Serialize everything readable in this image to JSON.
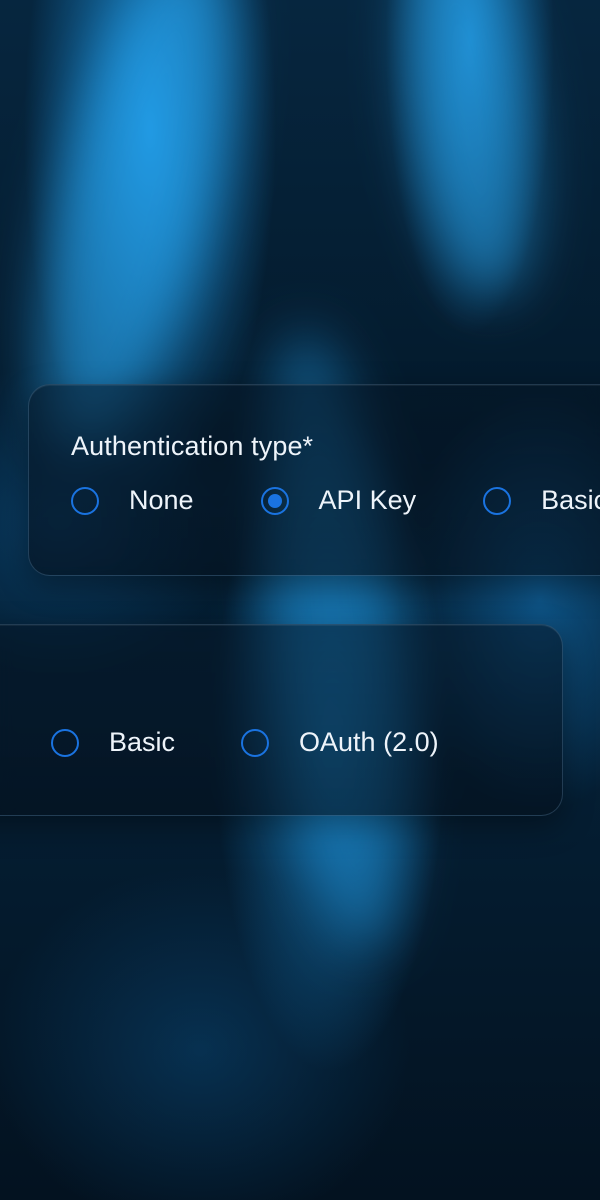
{
  "auth_card_primary": {
    "title": "Authentication type*",
    "options": [
      {
        "label": "None",
        "selected": false
      },
      {
        "label": "API Key",
        "selected": true
      },
      {
        "label": "Basic",
        "selected": false
      }
    ]
  },
  "auth_card_secondary": {
    "options": [
      {
        "label": "Basic",
        "selected": false
      },
      {
        "label": "OAuth (2.0)",
        "selected": false
      }
    ]
  },
  "theme": {
    "accent": "#1a73e0",
    "text": "#eef4fa"
  }
}
